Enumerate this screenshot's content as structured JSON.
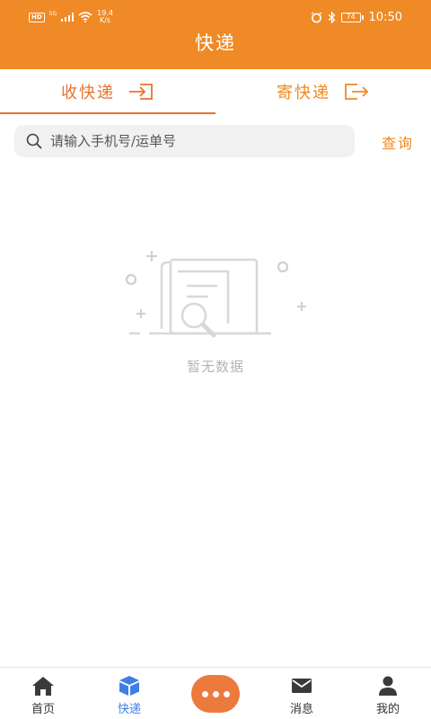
{
  "status_bar": {
    "hd": "HD",
    "network": "5G",
    "speed_value": "19.4",
    "speed_unit": "K/s",
    "battery": "74",
    "time": "10:50"
  },
  "header": {
    "title": "快递"
  },
  "tabs": [
    {
      "label": "收快递",
      "icon": "sign-in-icon",
      "active": true
    },
    {
      "label": "寄快递",
      "icon": "sign-out-icon",
      "active": false
    }
  ],
  "search": {
    "placeholder": "请输入手机号/运单号",
    "value": "",
    "button_label": "查询"
  },
  "empty_state": {
    "text": "暂无数据",
    "icon": "document-search-icon"
  },
  "tabbar": {
    "items": [
      {
        "label": "首页",
        "icon": "home-icon",
        "active": false
      },
      {
        "label": "快递",
        "icon": "package-icon",
        "active": true
      },
      {
        "label": "消息",
        "icon": "mail-icon",
        "active": false
      },
      {
        "label": "我的",
        "icon": "person-icon",
        "active": false
      }
    ],
    "center_icon": "more-dots-icon"
  },
  "colors": {
    "brand": "#ef8a26",
    "tab_active": "#e8732f",
    "tabbar_active": "#3f7fe4",
    "center_button": "#ec7a3c"
  }
}
